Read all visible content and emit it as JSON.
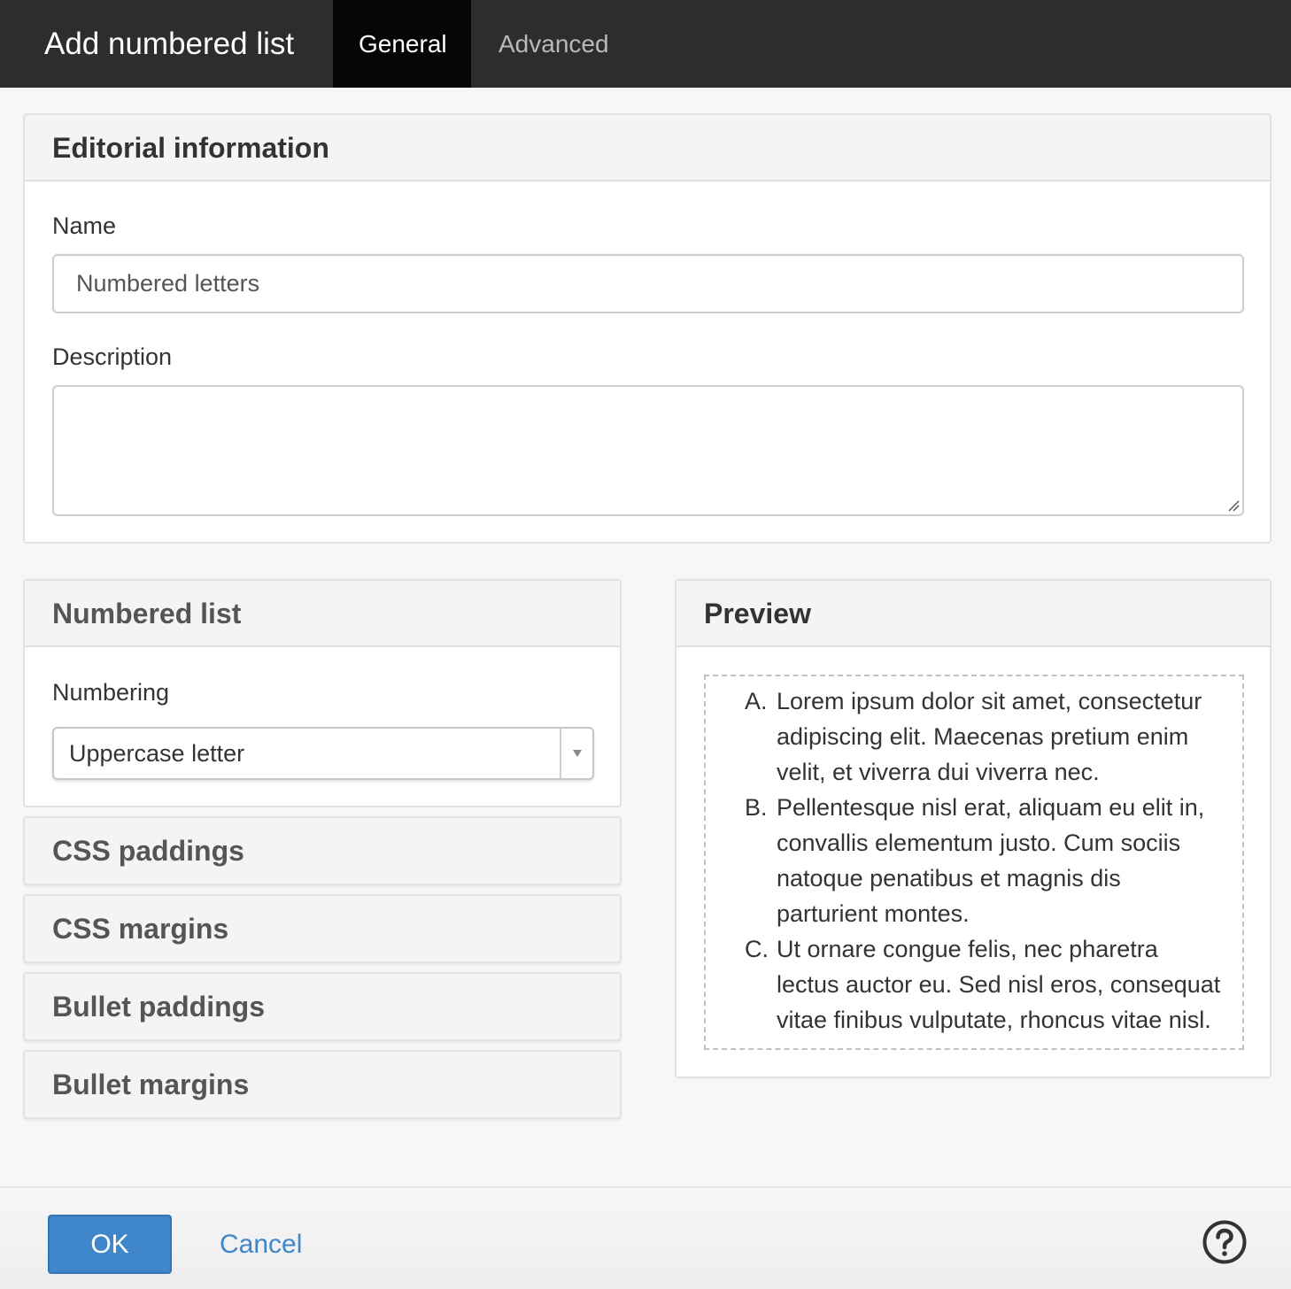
{
  "dialog": {
    "title": "Add numbered list"
  },
  "tabs": [
    {
      "label": "General",
      "active": true
    },
    {
      "label": "Advanced",
      "active": false
    }
  ],
  "editorial": {
    "heading": "Editorial information",
    "name_label": "Name",
    "name_value": "Numbered letters",
    "description_label": "Description",
    "description_value": ""
  },
  "numbered_list": {
    "heading": "Numbered list",
    "numbering_label": "Numbering",
    "numbering_selected": "Uppercase letter"
  },
  "sections": [
    {
      "label": "CSS paddings"
    },
    {
      "label": "CSS margins"
    },
    {
      "label": "Bullet paddings"
    },
    {
      "label": "Bullet margins"
    }
  ],
  "preview": {
    "heading": "Preview",
    "items": [
      {
        "marker": "A.",
        "lines": [
          "Lorem ipsum dolor sit amet, consectetur",
          "adipiscing elit. Maecenas pretium enim",
          "velit, et viverra dui viverra nec."
        ]
      },
      {
        "marker": "B.",
        "lines": [
          "Pellentesque nisl erat, aliquam eu elit in,",
          "convallis elementum justo. Cum sociis",
          "natoque penatibus et magnis dis",
          "parturient montes."
        ]
      },
      {
        "marker": "C.",
        "lines": [
          "Ut ornare congue felis, nec pharetra",
          "lectus auctor eu. Sed nisl eros, consequat",
          "vitae finibus vulputate, rhoncus vitae nisl."
        ]
      }
    ]
  },
  "footer": {
    "ok_label": "OK",
    "cancel_label": "Cancel",
    "help_icon": "question-circle-icon"
  },
  "colors": {
    "topbar": "#2d2d2d",
    "active_tab": "#050505",
    "primary": "#3f86cb"
  }
}
